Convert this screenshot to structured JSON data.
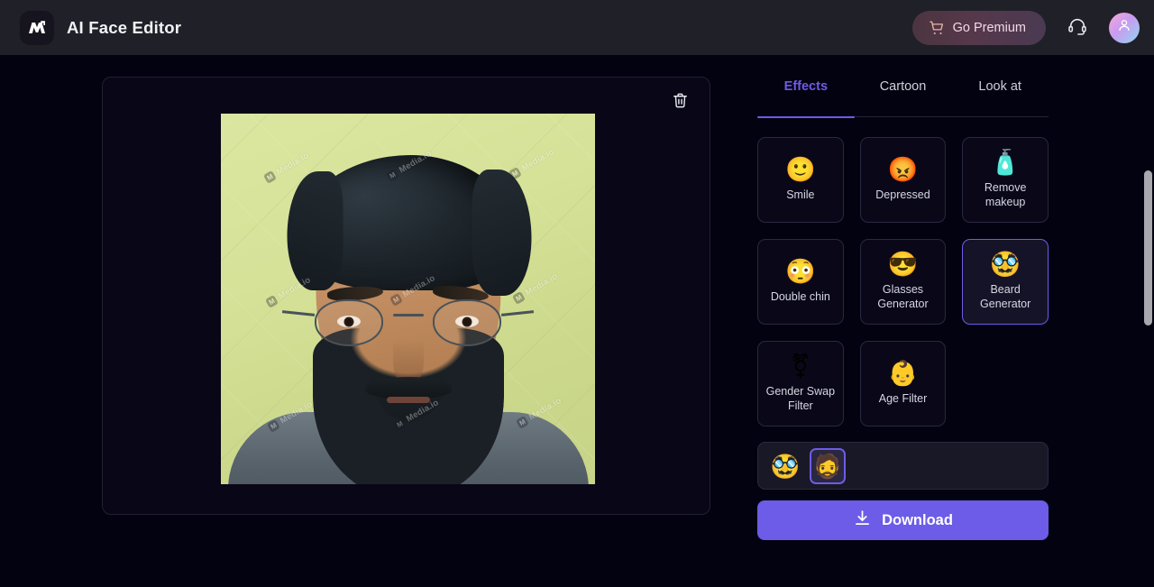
{
  "header": {
    "logo_letter": "M",
    "title": "AI Face Editor",
    "premium_label": "Go Premium",
    "cart_icon": "cart-icon",
    "support_icon": "headset-icon",
    "avatar_icon": "user-avatar-icon",
    "background_color": "#202028"
  },
  "canvas": {
    "delete_icon": "trash-icon",
    "watermark_text": "Media.io",
    "watermark_badge": "M",
    "panel_background": "#080617"
  },
  "sidebar": {
    "tabs": [
      {
        "label": "Effects",
        "active": true
      },
      {
        "label": "Cartoon",
        "active": false
      },
      {
        "label": "Look at",
        "active": false
      }
    ],
    "active_tab_color": "#6c5ce7",
    "effects": [
      {
        "label": "Smile",
        "emoji": "🙂",
        "icon": "smile-face-icon",
        "selected": false
      },
      {
        "label": "Depressed",
        "emoji": "😡",
        "icon": "angry-face-icon",
        "selected": false
      },
      {
        "label": "Remove makeup",
        "emoji": "🧴",
        "icon": "lotion-bottle-icon",
        "selected": false
      },
      {
        "label": "Double chin",
        "emoji": "😳",
        "icon": "flushed-face-icon",
        "selected": false
      },
      {
        "label": "Glasses Generator",
        "emoji": "😎",
        "icon": "sunglasses-face-icon",
        "selected": false
      },
      {
        "label": "Beard Generator",
        "emoji": "🥸",
        "icon": "disguised-face-icon",
        "selected": true
      },
      {
        "label": "Gender Swap Filter",
        "emoji": "⚧",
        "icon": "gender-swap-icon",
        "selected": false
      },
      {
        "label": "Age Filter",
        "emoji": "👶",
        "icon": "baby-face-icon",
        "selected": false
      }
    ],
    "variants": [
      {
        "emoji": "🥸",
        "icon": "mustache-face-thumbnail",
        "selected": false
      },
      {
        "emoji": "🧔",
        "icon": "bearded-face-thumbnail",
        "selected": true
      }
    ],
    "download_label": "Download",
    "download_icon": "download-icon",
    "download_color": "#6c5ce7"
  },
  "scrollbar": {
    "thumb_color": "#a8a8ae"
  }
}
